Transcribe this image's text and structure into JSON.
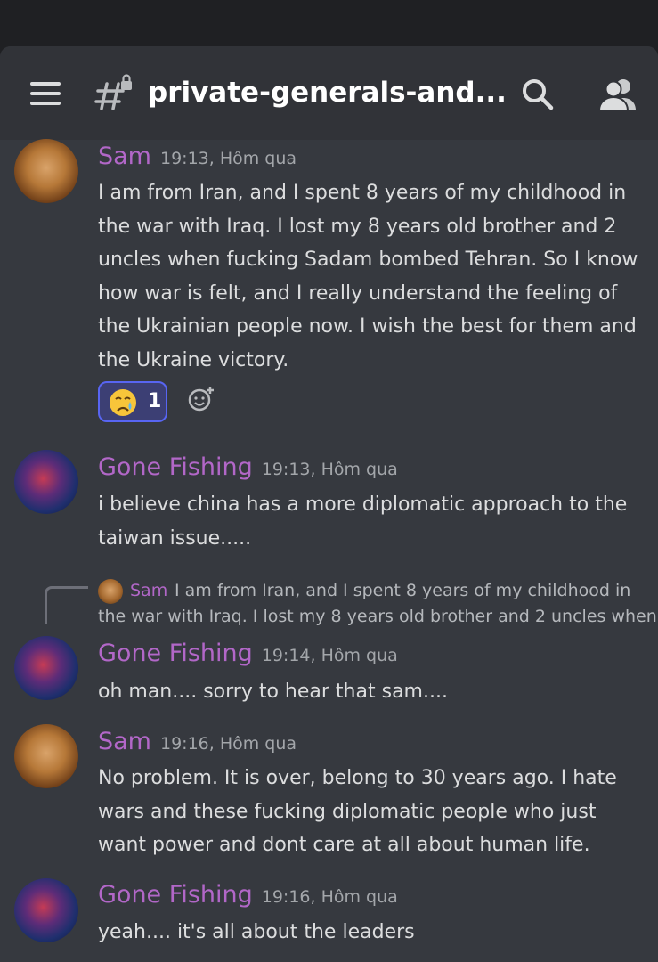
{
  "header": {
    "channel_name": "private-generals-and..."
  },
  "messages": [
    {
      "author": "Sam",
      "timestamp": "19:13, Hôm qua",
      "body": "I am from Iran, and I spent 8 years of my childhood in the war with Iraq. I lost my 8 years old brother and 2 uncles when fucking Sadam bombed Tehran. So I know how war is felt, and I really understand the feeling of the Ukrainian people now. I wish the best for them and the Ukraine victory.",
      "reaction": {
        "emoji": "crying-face",
        "count": "1"
      }
    },
    {
      "author": "Gone Fishing",
      "timestamp": "19:13, Hôm qua",
      "body": "i believe china has a more diplomatic approach to the taiwan issue....."
    },
    {
      "reply": {
        "author": "Sam",
        "line1": "I am from Iran, and I spent 8 years of my childhood in",
        "line2": "the war with Iraq. I lost my 8 years old brother and 2 uncles when"
      },
      "author": "Gone Fishing",
      "timestamp": "19:14, Hôm qua",
      "body": "oh man.... sorry to hear that sam...."
    },
    {
      "author": "Sam",
      "timestamp": "19:16, Hôm qua",
      "body": "No problem. It is over, belong to 30 years ago. I hate wars and these fucking diplomatic people who just want power and dont care at all about human life."
    },
    {
      "author": "Gone Fishing",
      "timestamp": "19:16, Hôm qua",
      "body": "yeah.... it's all about the leaders"
    }
  ],
  "icons": {
    "menu": "hamburger-menu-icon",
    "channel": "text-channel-lock-icon",
    "search": "search-icon",
    "members": "members-icon",
    "add_reaction": "add-reaction-icon"
  },
  "colors": {
    "background": "#36393f",
    "header": "#313338",
    "author": "#b267c8",
    "text": "#dcddde",
    "timestamp": "#a3a6aa",
    "reaction_border": "#5865f2"
  }
}
